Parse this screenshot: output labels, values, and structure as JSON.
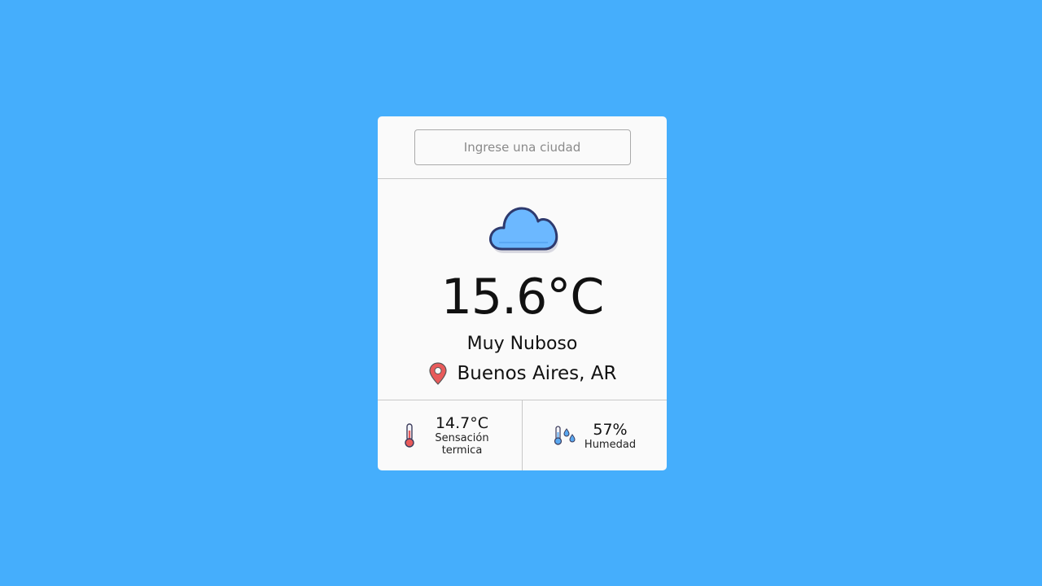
{
  "search": {
    "placeholder": "Ingrese una ciudad",
    "value": ""
  },
  "weather": {
    "icon": "cloud-icon",
    "temperature": "15.6°C",
    "description": "Muy Nuboso",
    "location": "Buenos Aires, AR"
  },
  "stats": {
    "feels_like": {
      "icon": "thermometer-icon",
      "value": "14.7°C",
      "label": "Sensación termica"
    },
    "humidity": {
      "icon": "humidity-icon",
      "value": "57%",
      "label": "Humedad"
    }
  },
  "colors": {
    "background": "#45aefc",
    "card": "#fafafa",
    "cloud_fill": "#6cb8ff",
    "cloud_outline": "#2e3a6e",
    "pin": "#e85a5a"
  }
}
